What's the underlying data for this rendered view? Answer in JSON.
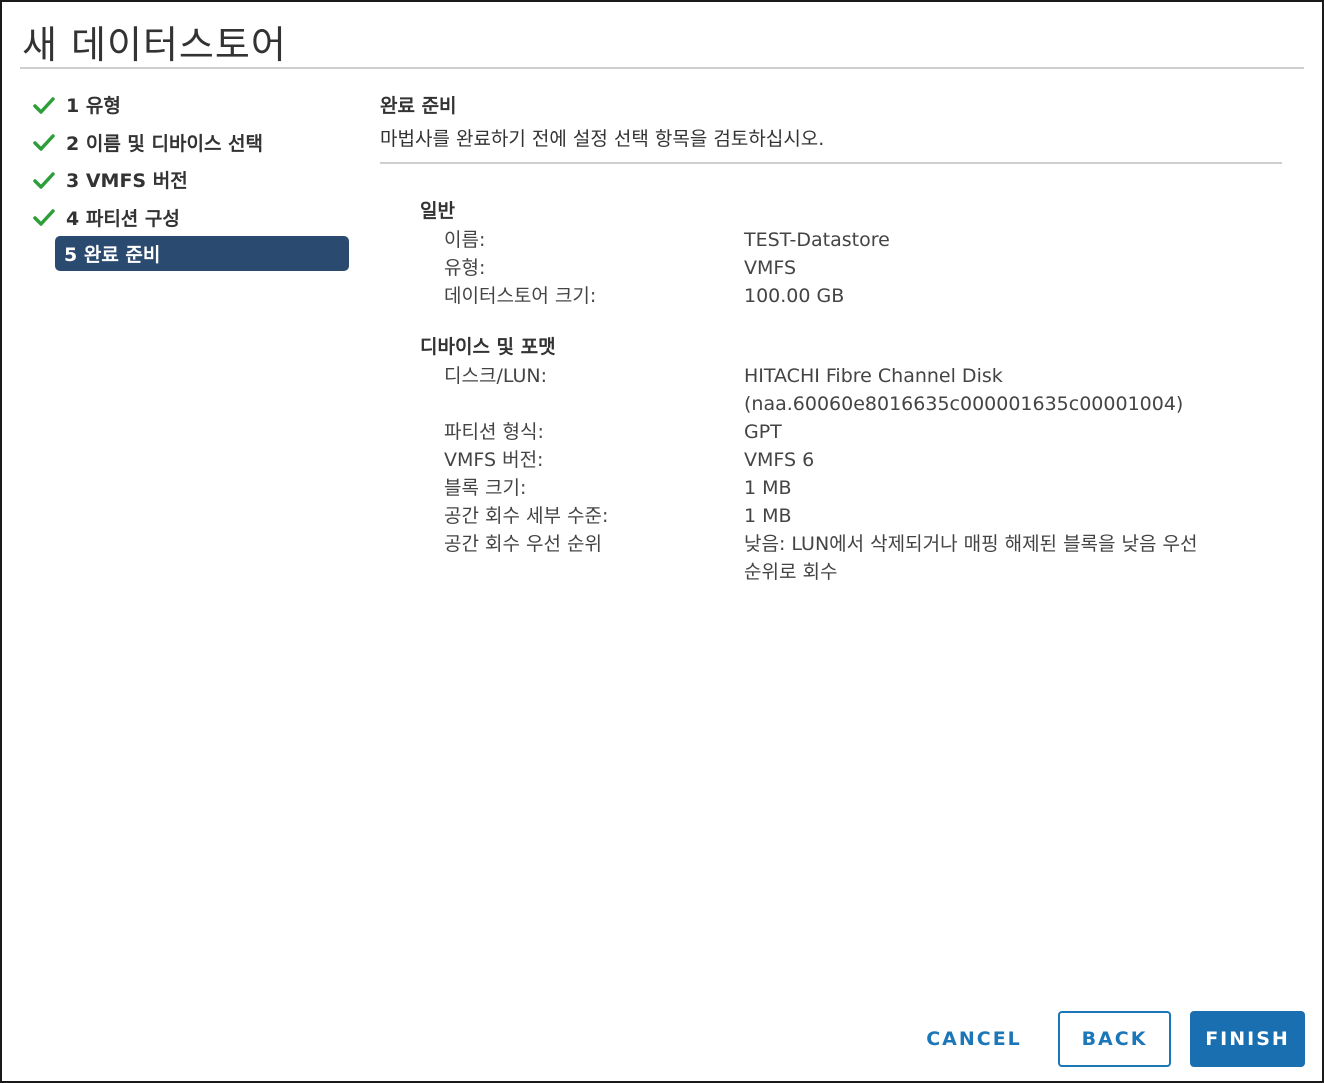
{
  "dialog": {
    "title": "새 데이터스토어"
  },
  "steps": [
    {
      "label": "1 유형",
      "done": true
    },
    {
      "label": "2 이름 및 디바이스 선택",
      "done": true
    },
    {
      "label": "3 VMFS 버전",
      "done": true
    },
    {
      "label": "4 파티션 구성",
      "done": true
    },
    {
      "label": "5 완료 준비",
      "done": false,
      "active": true
    }
  ],
  "main": {
    "title": "완료 준비",
    "description": "마법사를 완료하기 전에 설정 선택 항목을 검토하십시오.",
    "general": {
      "title": "일반",
      "rows": [
        {
          "label": "이름:",
          "value": "TEST-Datastore"
        },
        {
          "label": "유형:",
          "value": "VMFS"
        },
        {
          "label": "데이터스토어 크기:",
          "value": "100.00 GB"
        }
      ]
    },
    "device": {
      "title": "디바이스 및 포맷",
      "rows": [
        {
          "label": "디스크/LUN:",
          "value": "HITACHI Fibre Channel Disk",
          "value2": "(naa.60060e8016635c000001635c00001004)"
        },
        {
          "label": "파티션 형식:",
          "value": "GPT"
        },
        {
          "label": "VMFS 버전:",
          "value": "VMFS 6"
        },
        {
          "label": "블록 크기:",
          "value": "1 MB"
        },
        {
          "label": "공간 회수 세부 수준:",
          "value": "1 MB"
        },
        {
          "label": "공간 회수 우선 순위",
          "value": "낮음: LUN에서 삭제되거나 매핑 해제된 블록을 낮음 우선",
          "value2": "순위로 회수"
        }
      ]
    }
  },
  "footer": {
    "cancel_label": "CANCEL",
    "back_label": "BACK",
    "finish_label": "FINISH"
  },
  "colors": {
    "active_step_bg": "#2b4a6f",
    "check_green": "#2e9e3b",
    "primary_blue": "#1a6fb0",
    "link_blue": "#1c77b8"
  },
  "icons": {
    "step_done": "checkmark-icon"
  }
}
